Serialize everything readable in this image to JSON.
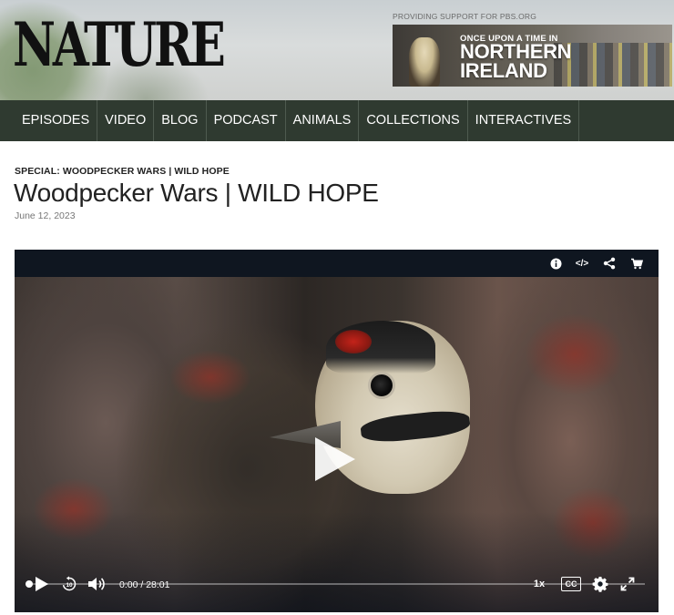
{
  "site": {
    "logo": "NATURE",
    "support_text": "PROVIDING SUPPORT FOR PBS.ORG",
    "ad": {
      "line1": "ONCE UPON A TIME IN",
      "line2": "NORTHERN",
      "line3": "IRELAND"
    }
  },
  "nav": {
    "items": [
      {
        "label": "EPISODES"
      },
      {
        "label": "VIDEO"
      },
      {
        "label": "BLOG"
      },
      {
        "label": "PODCAST"
      },
      {
        "label": "ANIMALS"
      },
      {
        "label": "COLLECTIONS"
      },
      {
        "label": "INTERACTIVES"
      }
    ]
  },
  "article": {
    "eyebrow": "SPECIAL: WOODPECKER WARS | WILD HOPE",
    "title": "Woodpecker Wars | WILD HOPE",
    "date": "June 12, 2023"
  },
  "player": {
    "top_icons": [
      "info-icon",
      "embed-icon",
      "share-icon",
      "cart-icon"
    ],
    "embed_glyph": "</>",
    "current_time": "0:00",
    "separator": "/",
    "duration": "28:01",
    "speed": "1x",
    "cc_label": "CC",
    "replay_seconds": "10",
    "progress_fraction": 0.0
  }
}
